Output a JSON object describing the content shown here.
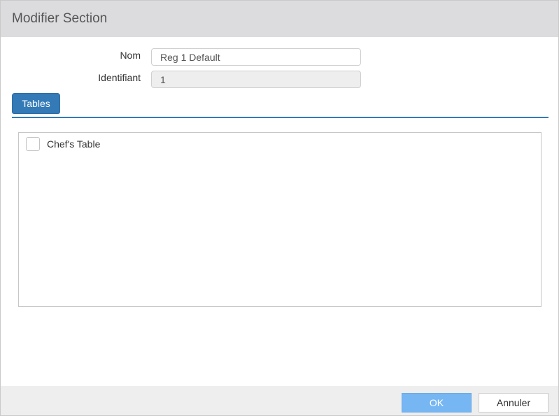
{
  "dialog": {
    "title": "Modifier Section"
  },
  "form": {
    "name_label": "Nom",
    "name_value": "Reg 1 Default",
    "id_label": "Identifiant",
    "id_value": "1"
  },
  "tabs": [
    {
      "label": "Tables",
      "active": true
    }
  ],
  "tables_list": {
    "items": [
      {
        "label": "Chef's Table",
        "checked": false
      }
    ]
  },
  "footer": {
    "ok_label": "OK",
    "cancel_label": "Annuler"
  },
  "colors": {
    "accent": "#337ab7",
    "ok_button": "#76b6f2",
    "header_bg": "#dcdcdf",
    "footer_bg": "#eeeeee"
  }
}
